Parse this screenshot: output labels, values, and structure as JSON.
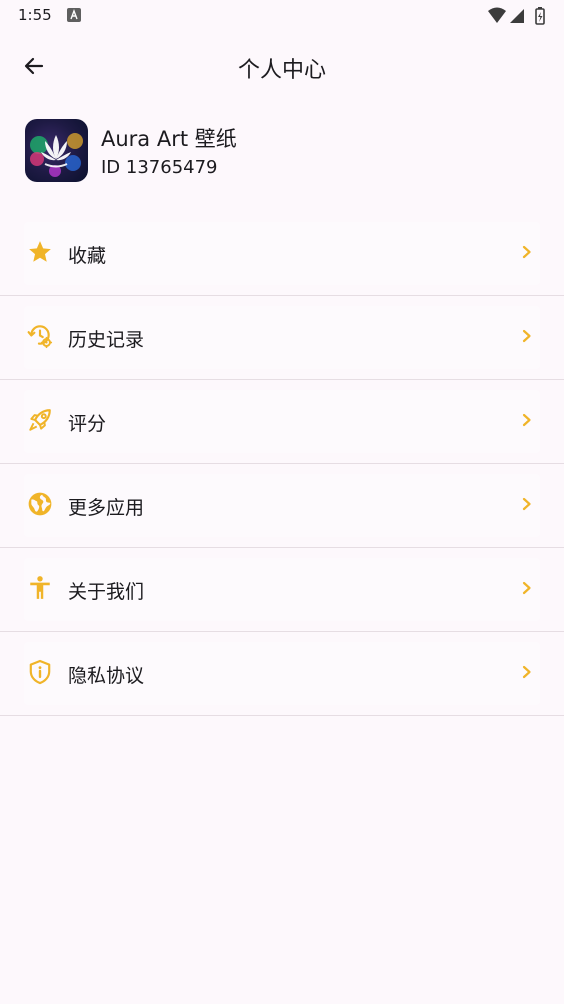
{
  "status_bar": {
    "time": "1:55",
    "icons": [
      "a-notification-icon",
      "wifi-icon",
      "signal-icon",
      "battery-charging-icon"
    ]
  },
  "app_bar": {
    "title": "个人中心",
    "back_icon": "arrow-left-icon"
  },
  "profile": {
    "name": "Aura Art 壁纸",
    "id_text": "ID 13765479"
  },
  "accent_color": "#f0b429",
  "menu": [
    {
      "label": "收藏",
      "icon": "star-icon"
    },
    {
      "label": "历史记录",
      "icon": "history-gear-icon"
    },
    {
      "label": "评分",
      "icon": "rocket-icon"
    },
    {
      "label": "更多应用",
      "icon": "globe-icon"
    },
    {
      "label": "关于我们",
      "icon": "accessibility-person-icon"
    },
    {
      "label": "隐私协议",
      "icon": "shield-info-icon"
    }
  ]
}
